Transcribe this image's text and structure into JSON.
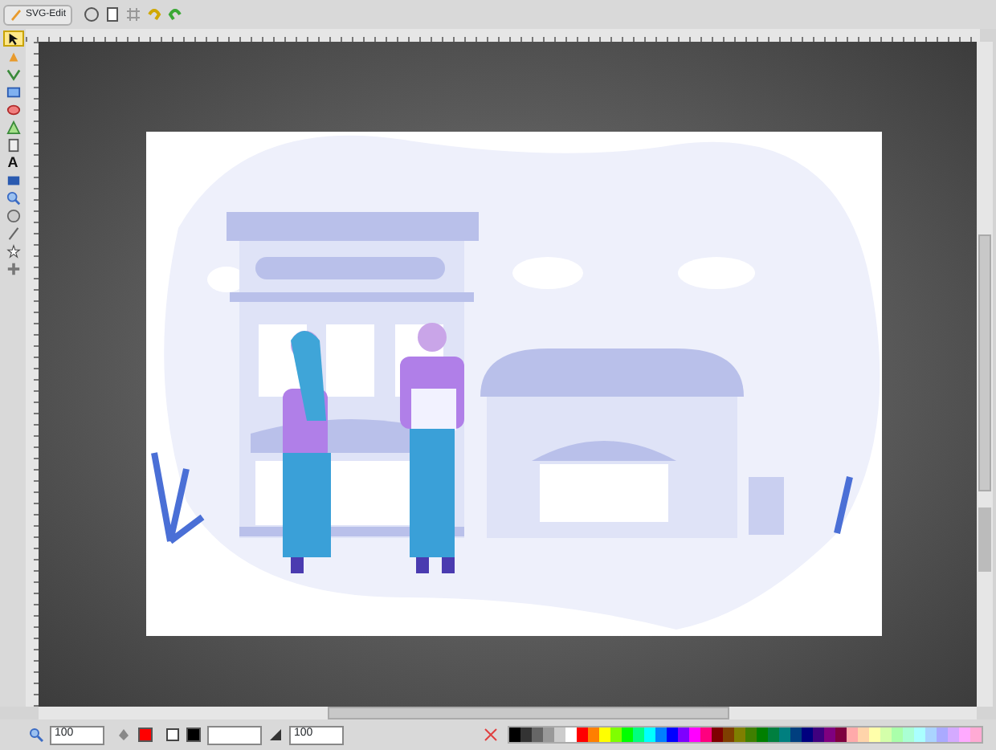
{
  "app": {
    "logo": "SVG-Edit"
  },
  "top_tools": [
    {
      "kind": "wireframe"
    },
    {
      "kind": "docprops"
    },
    {
      "kind": "grid"
    },
    {
      "kind": "undo"
    },
    {
      "kind": "redo"
    }
  ],
  "tools": [
    {
      "kind": "select",
      "selected": true
    },
    {
      "kind": "node",
      "selected": false
    },
    {
      "kind": "pen",
      "selected": false
    },
    {
      "kind": "rect",
      "selected": false
    },
    {
      "kind": "ellipse",
      "selected": false
    },
    {
      "kind": "triangle",
      "selected": false
    },
    {
      "kind": "page",
      "selected": false
    },
    {
      "kind": "text",
      "label": "A",
      "selected": false
    },
    {
      "kind": "image",
      "selected": false
    },
    {
      "kind": "zoom",
      "selected": false
    },
    {
      "kind": "circle",
      "selected": false
    },
    {
      "kind": "line",
      "selected": false
    },
    {
      "kind": "star",
      "selected": false
    },
    {
      "kind": "move",
      "selected": false
    }
  ],
  "zoom": {
    "value": "100"
  },
  "fill": {
    "color": "#ff0000"
  },
  "stroke": {
    "color": "#000000"
  },
  "opacity": {
    "value": "100"
  },
  "palette": [
    {
      "color": "#000000"
    },
    {
      "color": "#333333"
    },
    {
      "color": "#666666"
    },
    {
      "color": "#999999"
    },
    {
      "color": "#cccccc"
    },
    {
      "color": "#ffffff"
    },
    {
      "color": "#ff0000"
    },
    {
      "color": "#ff7f00"
    },
    {
      "color": "#ffff00"
    },
    {
      "color": "#7fff00"
    },
    {
      "color": "#00ff00"
    },
    {
      "color": "#00ff7f"
    },
    {
      "color": "#00ffff"
    },
    {
      "color": "#007fff"
    },
    {
      "color": "#0000ff"
    },
    {
      "color": "#7f00ff"
    },
    {
      "color": "#ff00ff"
    },
    {
      "color": "#ff007f"
    },
    {
      "color": "#7f0000"
    },
    {
      "color": "#7f3f00"
    },
    {
      "color": "#7f7f00"
    },
    {
      "color": "#3f7f00"
    },
    {
      "color": "#007f00"
    },
    {
      "color": "#007f3f"
    },
    {
      "color": "#007f7f"
    },
    {
      "color": "#003f7f"
    },
    {
      "color": "#00007f"
    },
    {
      "color": "#3f007f"
    },
    {
      "color": "#7f007f"
    },
    {
      "color": "#7f003f"
    },
    {
      "color": "#ffaaaa"
    },
    {
      "color": "#ffd4aa"
    },
    {
      "color": "#ffffaa"
    },
    {
      "color": "#d4ffaa"
    },
    {
      "color": "#aaffaa"
    },
    {
      "color": "#aaffd4"
    },
    {
      "color": "#aaffff"
    },
    {
      "color": "#aad4ff"
    },
    {
      "color": "#aaaaff"
    },
    {
      "color": "#d4aaff"
    },
    {
      "color": "#ffaaff"
    },
    {
      "color": "#ffaad4"
    }
  ]
}
